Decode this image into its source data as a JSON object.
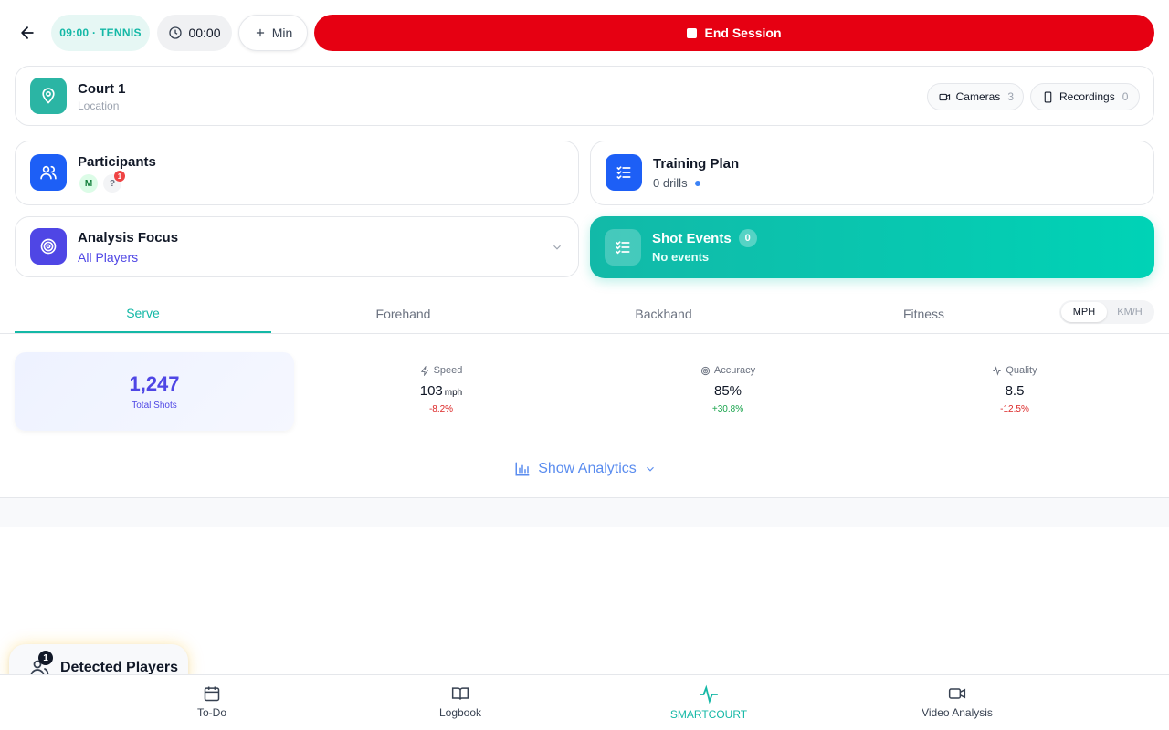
{
  "header": {
    "sport_label": "09:00 · TENNIS",
    "timer": "00:00",
    "add_min_label": "Min",
    "end_session_label": "End Session"
  },
  "court": {
    "title": "Court 1",
    "subtitle": "Location",
    "cameras_label": "Cameras",
    "cameras_count": "3",
    "recordings_label": "Recordings",
    "recordings_count": "0"
  },
  "participants": {
    "title": "Participants",
    "avatars": [
      "M",
      "?"
    ],
    "badge": "1"
  },
  "training_plan": {
    "title": "Training Plan",
    "subtitle": "0 drills"
  },
  "analysis_focus": {
    "title": "Analysis Focus",
    "value": "All Players"
  },
  "shot_events": {
    "title": "Shot Events",
    "count": "0",
    "subtitle": "No events"
  },
  "tabs": [
    {
      "label": "Serve",
      "active": true
    },
    {
      "label": "Forehand",
      "active": false
    },
    {
      "label": "Backhand",
      "active": false
    },
    {
      "label": "Fitness",
      "active": false
    }
  ],
  "units": {
    "mph": "MPH",
    "kmh": "KM/H",
    "selected": "MPH"
  },
  "stats": {
    "total_value": "1,247",
    "total_label": "Total Shots",
    "speed": {
      "label": "Speed",
      "value": "103",
      "unit": "mph",
      "delta": "-8.2%"
    },
    "accuracy": {
      "label": "Accuracy",
      "value": "85%",
      "delta": "+30.8%"
    },
    "quality": {
      "label": "Quality",
      "value": "8.5",
      "delta": "-12.5%"
    }
  },
  "analytics_label": "Show Analytics",
  "detected_players": {
    "label": "Detected Players",
    "count": "1"
  },
  "bottom_nav": [
    {
      "label": "To-Do",
      "icon": "calendar-icon"
    },
    {
      "label": "Logbook",
      "icon": "book-icon"
    },
    {
      "label": "SMARTCOURT",
      "icon": "activity-icon",
      "active": true
    },
    {
      "label": "Video Analysis",
      "icon": "video-icon"
    }
  ],
  "colors": {
    "accent": "#14b8a6",
    "danger": "#e60012",
    "primary": "#1d5ff6",
    "indigo": "#4f46e5"
  }
}
